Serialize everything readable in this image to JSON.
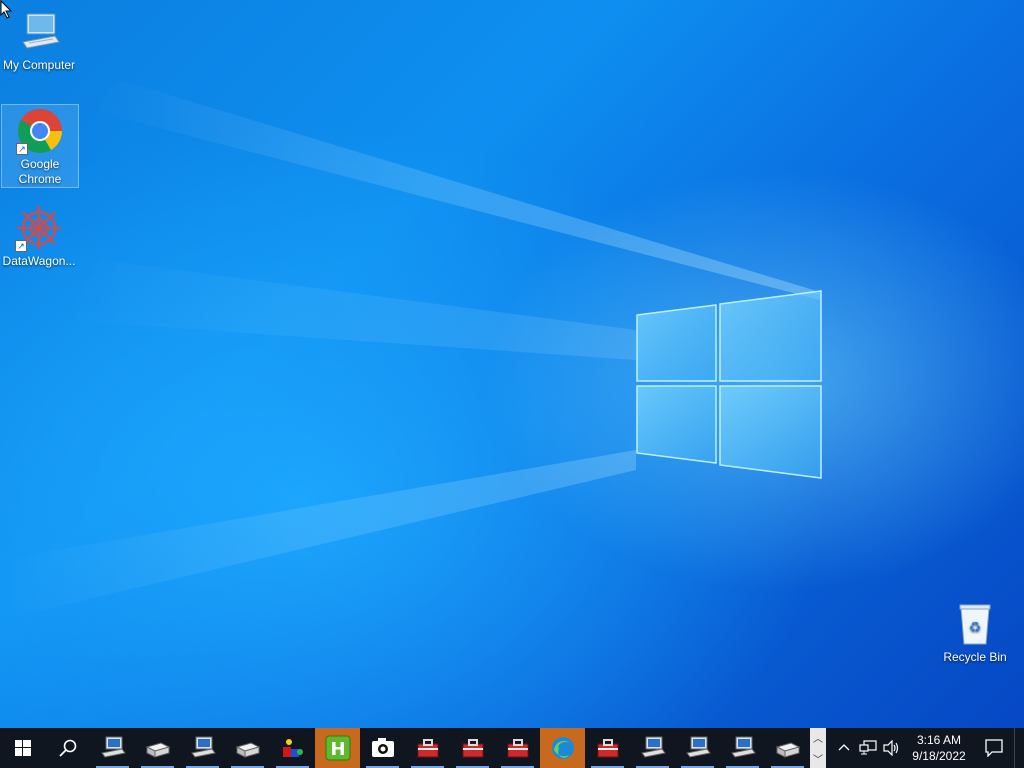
{
  "desktop": {
    "icons": [
      {
        "label": "My Computer",
        "name": "my-computer"
      },
      {
        "label": "Google Chrome",
        "name": "google-chrome"
      },
      {
        "label": "DataWagon...",
        "name": "datawagon"
      },
      {
        "label": "Recycle Bin",
        "name": "recycle-bin"
      }
    ]
  },
  "taskbar": {
    "icons": [
      "start-icon",
      "search-icon",
      "network-computer-icon",
      "drive-icon",
      "network-computer-icon",
      "drive-icon",
      "colored-blocks-icon",
      "h-app-icon",
      "camera-icon",
      "toolbox-icon",
      "toolbox-icon",
      "toolbox-icon",
      "edge-icon",
      "toolbox-icon",
      "network-computer-icon",
      "network-computer-icon",
      "network-computer-icon",
      "drive-icon"
    ],
    "clock": {
      "time": "3:16 AM",
      "date": "9/18/2022"
    }
  },
  "colors": {
    "taskbar": "#0f1620",
    "active_orange": "#c86a1e",
    "wallpaper_blue": "#0a6ee0"
  }
}
